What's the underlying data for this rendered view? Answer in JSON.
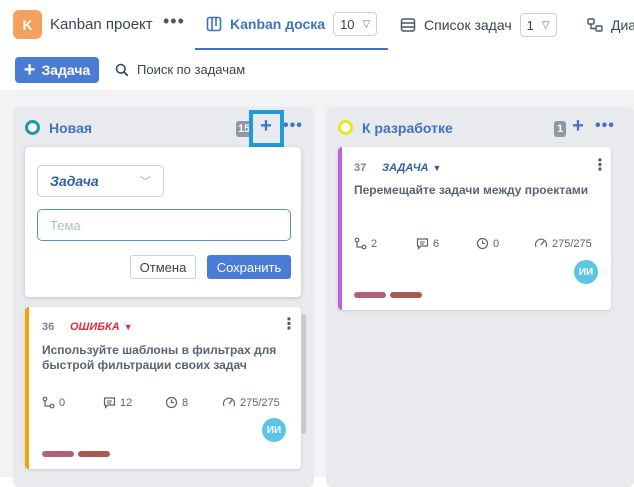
{
  "project": {
    "initial": "K",
    "name": "Kanban проект",
    "more": "•••"
  },
  "tabs": [
    {
      "label": "Kanban доска",
      "count": "10"
    },
    {
      "label": "Список задач",
      "count": "1"
    },
    {
      "label": "Диа"
    }
  ],
  "toolbar": {
    "add_task_label": "Задача",
    "search_placeholder": "Поиск по задачам"
  },
  "columns": [
    {
      "title": "Новая",
      "count": "15",
      "dot_color": "#1a9c9c",
      "add": "+",
      "more": "•••"
    },
    {
      "title": "К разработке",
      "count": "1",
      "dot_color": "#e8e81a",
      "add": "+",
      "more": "•••"
    }
  ],
  "new_task_form": {
    "type_value": "Задача",
    "theme_placeholder": "Тема",
    "cancel_label": "Отмена",
    "save_label": "Сохранить"
  },
  "cards": [
    {
      "id": "36",
      "type": "ОШИБКА",
      "type_color": "#d9303a",
      "accent": "#f0a500",
      "title": "Используйте шаблоны в фильтрах для быстрой фильтрации своих задач",
      "subtasks": "0",
      "comments": "12",
      "estimate": "8",
      "progress": "275/275",
      "assignee": "ИИ",
      "tags": [
        "#b5607a",
        "#a85a52"
      ]
    },
    {
      "id": "37",
      "type": "ЗАДАЧА",
      "type_color": "#2f5fa8",
      "accent": "#c25ee0",
      "title": "Перемещайте задачи между проектами",
      "subtasks": "2",
      "comments": "6",
      "estimate": "0",
      "progress": "275/275",
      "assignee": "ИИ",
      "tags": [
        "#b5607a",
        "#a85a52"
      ]
    }
  ]
}
